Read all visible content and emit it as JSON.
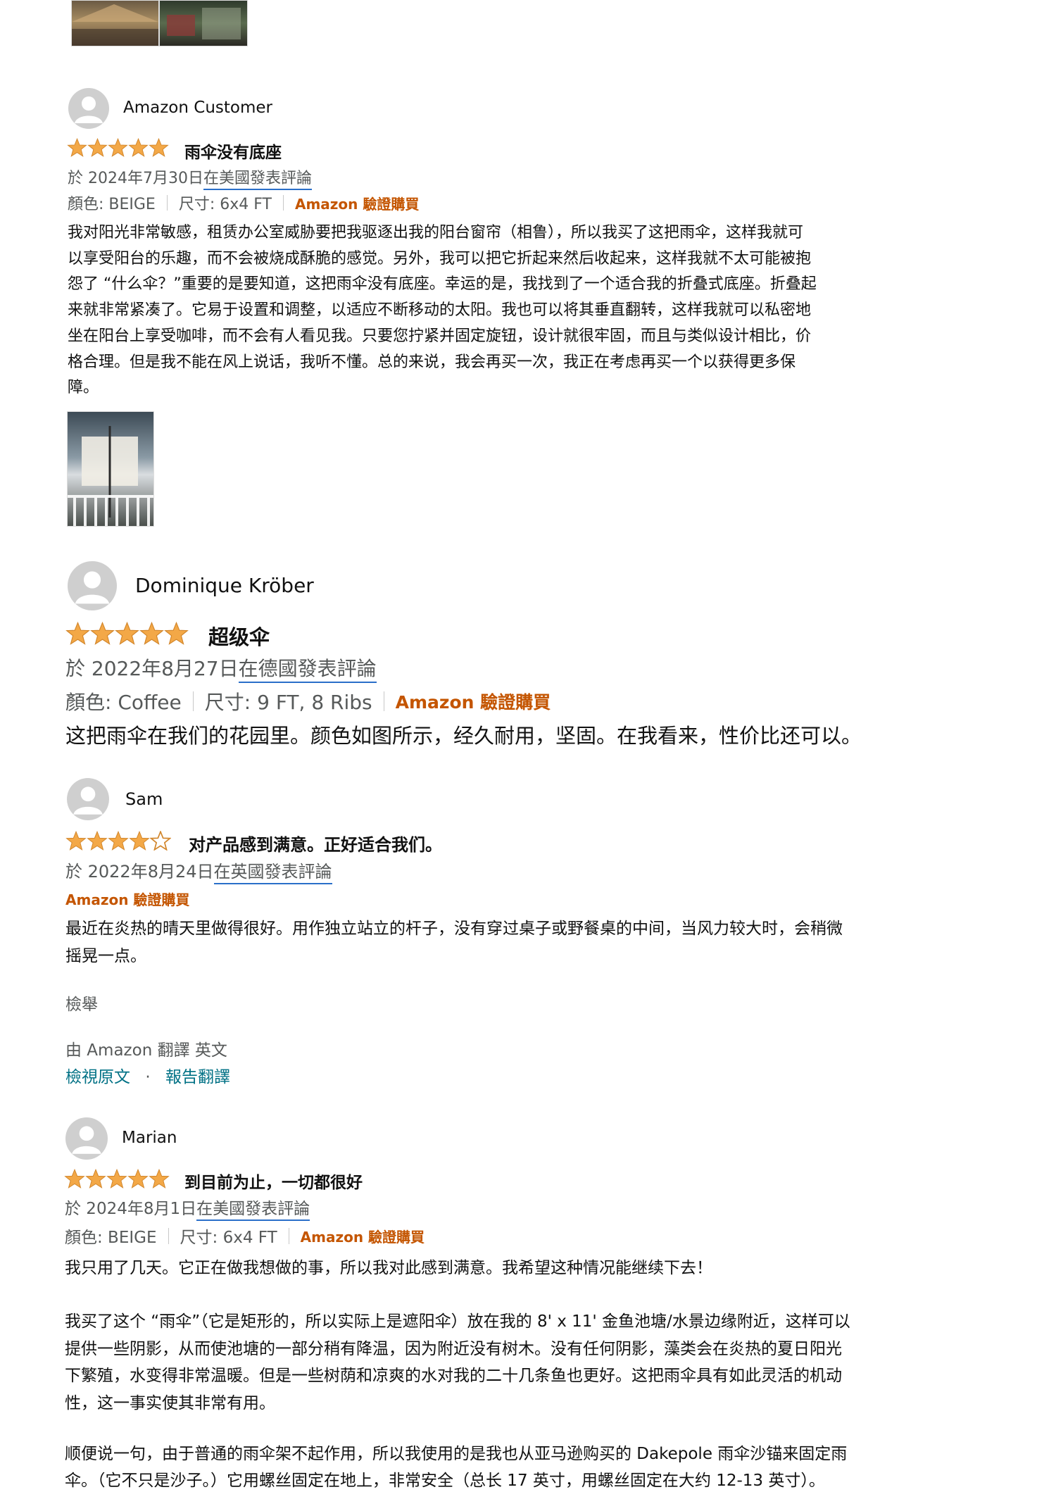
{
  "reviews": [
    {
      "author": "Amazon Customer",
      "rating": 5,
      "headline": "雨伞没有底座",
      "date_prefix": "於 2024年7月30日",
      "date_location": "在美國發表評論",
      "color": "顏色: BEIGE",
      "size": "尺寸: 6x4 FT",
      "verified": "Amazon 驗證購買",
      "body": "我对阳光非常敏感，租赁办公室威胁要把我驱逐出我的阳台窗帘（相鲁），所以我买了这把雨伞，这样我就可\n以享受阳台的乐趣，而不会被烧成酥脆的感觉。另外，我可以把它折起来然后收起来，这样我就不太可能被抱\n怨了 “什么伞？”重要的是要知道，这把雨伞没有底座。幸运的是，我找到了一个适合我的折叠式底座。折叠起\n来就非常紧凑了。它易于设置和调整，以适应不断移动的太阳。我也可以将其垂直翻转，这样我就可以私密地\n坐在阳台上享受咖啡，而不会有人看见我。只要您拧紧并固定旋钮，设计就很牢固，而且与类似设计相比，价\n格合理。但是我不能在风上说话，我听不懂。总的来说，我会再买一次，我正在考虑再买一个以获得更多保\n障。"
    },
    {
      "author": "Dominique Kröber",
      "rating": 5,
      "headline": "超级伞",
      "date_prefix": "於 2022年8月27日",
      "date_location": "在德國發表評論",
      "color": "顏色: Coffee",
      "size": "尺寸: 9 FT, 8 Ribs",
      "verified": "Amazon 驗證購買",
      "body": "这把雨伞在我们的花园里。颜色如图所示，经久耐用，坚固。在我看来，性价比还可以。"
    },
    {
      "author": "Sam",
      "rating": 4,
      "headline": "对产品感到满意。正好适合我们。",
      "date_prefix": "於 2022年8月24日",
      "date_location": "在英國發表評論",
      "verified": "Amazon 驗證購買",
      "body": "最近在炎热的晴天里做得很好。用作独立站立的杆子，没有穿过桌子或野餐桌的中间，当风力较大时，会稍微\n摇晃一点。",
      "report": "檢舉",
      "translated_by": "由 Amazon 翻譯 英文",
      "view_original": "檢視原文",
      "dot": "·",
      "report_translation": "報告翻譯"
    },
    {
      "author": "Marian",
      "rating": 5,
      "headline": "到目前为止，一切都很好",
      "date_prefix": "於 2024年8月1日",
      "date_location": "在美國發表評論",
      "color": "顏色: BEIGE",
      "size": "尺寸: 6x4 FT",
      "verified": "Amazon 驗證購買",
      "body_1": "我只用了几天。它正在做我想做的事，所以我对此感到满意。我希望这种情况能继续下去！",
      "body_2": "我买了这个 “雨伞”（它是矩形的，所以实际上是遮阳伞）放在我的 8' x 11' 金鱼池塘/水景边缘附近，这样可以\n提供一些阴影，从而使池塘的一部分稍有降温，因为附近没有树木。没有任何阴影，藻类会在炎热的夏日阳光\n下繁殖，水变得非常温暖。但是一些树荫和凉爽的水对我的二十几条鱼也更好。这把雨伞具有如此灵活的机动\n性，这一事实使其非常有用。",
      "body_3": "顺便说一句，由于普通的雨伞架不起作用，所以我使用的是我也从亚马逊购买的 Dakepole 雨伞沙锚来固定雨\n伞。（它不只是沙子。）它用螺丝固定在地上，非常安全（总长 17 英寸，用螺丝固定在大约 12-13 英寸）。"
    }
  ],
  "colors": {
    "star": "#f3a847",
    "verified": "#c45500",
    "link": "#007185",
    "muted": "#565959",
    "underline": "#2a6fc9"
  }
}
